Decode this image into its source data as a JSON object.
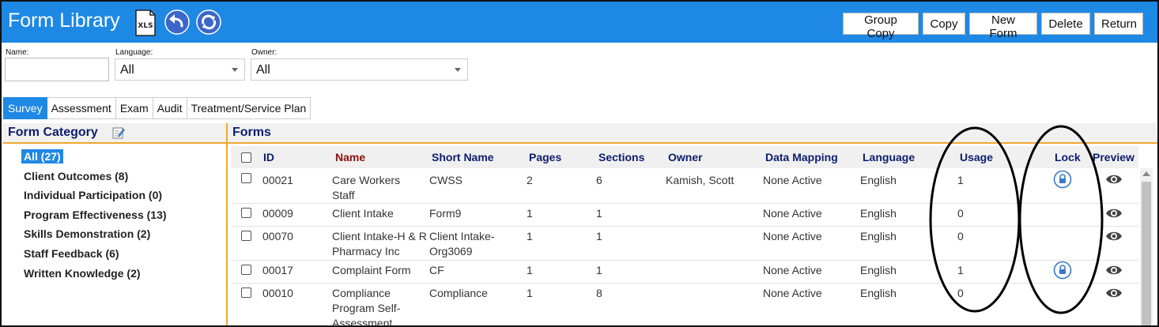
{
  "header": {
    "title": "Form Library",
    "xls_text": "XLS",
    "buttons": {
      "group_copy": "Group Copy",
      "copy": "Copy",
      "new_form": "New Form",
      "delete": "Delete",
      "return": "Return"
    }
  },
  "filters": {
    "name_label": "Name:",
    "name_value": "",
    "language_label": "Language:",
    "language_value": "All",
    "owner_label": "Owner:",
    "owner_value": "All"
  },
  "tabs": [
    "Survey",
    "Assessment",
    "Exam",
    "Audit",
    "Treatment/Service Plan"
  ],
  "category_panel": {
    "title": "Form Category",
    "items": [
      "All (27)",
      "Client Outcomes (8)",
      "Individual Participation (0)",
      "Program Effectiveness (13)",
      "Skills Demonstration (2)",
      "Staff Feedback (6)",
      "Written Knowledge (2)"
    ]
  },
  "forms_panel": {
    "title": "Forms",
    "columns": [
      "ID",
      "Name",
      "Short Name",
      "Pages",
      "Sections",
      "Owner",
      "Data Mapping",
      "Language",
      "Usage",
      "Lock",
      "Preview"
    ],
    "rows": [
      {
        "id": "00021",
        "name": "Care Workers Staff",
        "short_name": "CWSS",
        "pages": "2",
        "sections": "6",
        "owner": "Kamish, Scott",
        "data_mapping": "None Active",
        "language": "English",
        "usage": "1",
        "locked": true
      },
      {
        "id": "00009",
        "name": "Client Intake",
        "short_name": "Form9",
        "pages": "1",
        "sections": "1",
        "owner": "",
        "data_mapping": "None Active",
        "language": "English",
        "usage": "0",
        "locked": false
      },
      {
        "id": "00070",
        "name": "Client Intake-H & R Pharmacy Inc",
        "short_name": "Client Intake-Org3069",
        "pages": "1",
        "sections": "1",
        "owner": "",
        "data_mapping": "None Active",
        "language": "English",
        "usage": "0",
        "locked": false
      },
      {
        "id": "00017",
        "name": "Complaint Form",
        "short_name": "CF",
        "pages": "1",
        "sections": "1",
        "owner": "",
        "data_mapping": "None Active",
        "language": "English",
        "usage": "1",
        "locked": true
      },
      {
        "id": "00010",
        "name": "Compliance Program Self-Assessment",
        "short_name": "Compliance",
        "pages": "1",
        "sections": "8",
        "owner": "",
        "data_mapping": "None Active",
        "language": "English",
        "usage": "0",
        "locked": false
      }
    ]
  },
  "colors": {
    "header_blue": "#1E88E5",
    "accent_orange": "#F0A830",
    "heading_navy": "#0d1d6e",
    "name_header_red": "#8B1010"
  },
  "icons": [
    "xls-icon",
    "undo-icon",
    "refresh-icon",
    "pencil-icon",
    "lock-icon",
    "eye-icon"
  ]
}
